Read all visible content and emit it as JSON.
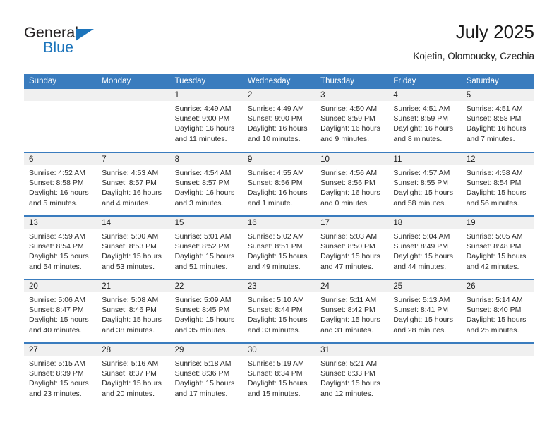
{
  "brand": {
    "name_top": "General",
    "name_bottom": "Blue",
    "triangle_color": "#1c74bb",
    "text_color": "#231f20"
  },
  "header": {
    "title": "July 2025",
    "subtitle": "Kojetin, Olomoucky, Czechia"
  },
  "theme": {
    "header_bg": "#3a7cbe",
    "header_text": "#ffffff",
    "daynum_band_bg": "#f0f0f0",
    "grid_line": "#3a7cbe",
    "body_text": "#2b2b2b"
  },
  "weekday_headers": [
    "Sunday",
    "Monday",
    "Tuesday",
    "Wednesday",
    "Thursday",
    "Friday",
    "Saturday"
  ],
  "labels": {
    "sunrise_prefix": "Sunrise:",
    "sunset_prefix": "Sunset:",
    "daylight_prefix": "Daylight:"
  },
  "weeks": [
    [
      {
        "day": "",
        "empty": true,
        "lines": []
      },
      {
        "day": "",
        "empty": true,
        "lines": []
      },
      {
        "day": "1",
        "empty": false,
        "lines": [
          "Sunrise: 4:49 AM",
          "Sunset: 9:00 PM",
          "Daylight: 16 hours",
          "and 11 minutes."
        ]
      },
      {
        "day": "2",
        "empty": false,
        "lines": [
          "Sunrise: 4:49 AM",
          "Sunset: 9:00 PM",
          "Daylight: 16 hours",
          "and 10 minutes."
        ]
      },
      {
        "day": "3",
        "empty": false,
        "lines": [
          "Sunrise: 4:50 AM",
          "Sunset: 8:59 PM",
          "Daylight: 16 hours",
          "and 9 minutes."
        ]
      },
      {
        "day": "4",
        "empty": false,
        "lines": [
          "Sunrise: 4:51 AM",
          "Sunset: 8:59 PM",
          "Daylight: 16 hours",
          "and 8 minutes."
        ]
      },
      {
        "day": "5",
        "empty": false,
        "lines": [
          "Sunrise: 4:51 AM",
          "Sunset: 8:58 PM",
          "Daylight: 16 hours",
          "and 7 minutes."
        ]
      }
    ],
    [
      {
        "day": "6",
        "empty": false,
        "lines": [
          "Sunrise: 4:52 AM",
          "Sunset: 8:58 PM",
          "Daylight: 16 hours",
          "and 5 minutes."
        ]
      },
      {
        "day": "7",
        "empty": false,
        "lines": [
          "Sunrise: 4:53 AM",
          "Sunset: 8:57 PM",
          "Daylight: 16 hours",
          "and 4 minutes."
        ]
      },
      {
        "day": "8",
        "empty": false,
        "lines": [
          "Sunrise: 4:54 AM",
          "Sunset: 8:57 PM",
          "Daylight: 16 hours",
          "and 3 minutes."
        ]
      },
      {
        "day": "9",
        "empty": false,
        "lines": [
          "Sunrise: 4:55 AM",
          "Sunset: 8:56 PM",
          "Daylight: 16 hours",
          "and 1 minute."
        ]
      },
      {
        "day": "10",
        "empty": false,
        "lines": [
          "Sunrise: 4:56 AM",
          "Sunset: 8:56 PM",
          "Daylight: 16 hours",
          "and 0 minutes."
        ]
      },
      {
        "day": "11",
        "empty": false,
        "lines": [
          "Sunrise: 4:57 AM",
          "Sunset: 8:55 PM",
          "Daylight: 15 hours",
          "and 58 minutes."
        ]
      },
      {
        "day": "12",
        "empty": false,
        "lines": [
          "Sunrise: 4:58 AM",
          "Sunset: 8:54 PM",
          "Daylight: 15 hours",
          "and 56 minutes."
        ]
      }
    ],
    [
      {
        "day": "13",
        "empty": false,
        "lines": [
          "Sunrise: 4:59 AM",
          "Sunset: 8:54 PM",
          "Daylight: 15 hours",
          "and 54 minutes."
        ]
      },
      {
        "day": "14",
        "empty": false,
        "lines": [
          "Sunrise: 5:00 AM",
          "Sunset: 8:53 PM",
          "Daylight: 15 hours",
          "and 53 minutes."
        ]
      },
      {
        "day": "15",
        "empty": false,
        "lines": [
          "Sunrise: 5:01 AM",
          "Sunset: 8:52 PM",
          "Daylight: 15 hours",
          "and 51 minutes."
        ]
      },
      {
        "day": "16",
        "empty": false,
        "lines": [
          "Sunrise: 5:02 AM",
          "Sunset: 8:51 PM",
          "Daylight: 15 hours",
          "and 49 minutes."
        ]
      },
      {
        "day": "17",
        "empty": false,
        "lines": [
          "Sunrise: 5:03 AM",
          "Sunset: 8:50 PM",
          "Daylight: 15 hours",
          "and 47 minutes."
        ]
      },
      {
        "day": "18",
        "empty": false,
        "lines": [
          "Sunrise: 5:04 AM",
          "Sunset: 8:49 PM",
          "Daylight: 15 hours",
          "and 44 minutes."
        ]
      },
      {
        "day": "19",
        "empty": false,
        "lines": [
          "Sunrise: 5:05 AM",
          "Sunset: 8:48 PM",
          "Daylight: 15 hours",
          "and 42 minutes."
        ]
      }
    ],
    [
      {
        "day": "20",
        "empty": false,
        "lines": [
          "Sunrise: 5:06 AM",
          "Sunset: 8:47 PM",
          "Daylight: 15 hours",
          "and 40 minutes."
        ]
      },
      {
        "day": "21",
        "empty": false,
        "lines": [
          "Sunrise: 5:08 AM",
          "Sunset: 8:46 PM",
          "Daylight: 15 hours",
          "and 38 minutes."
        ]
      },
      {
        "day": "22",
        "empty": false,
        "lines": [
          "Sunrise: 5:09 AM",
          "Sunset: 8:45 PM",
          "Daylight: 15 hours",
          "and 35 minutes."
        ]
      },
      {
        "day": "23",
        "empty": false,
        "lines": [
          "Sunrise: 5:10 AM",
          "Sunset: 8:44 PM",
          "Daylight: 15 hours",
          "and 33 minutes."
        ]
      },
      {
        "day": "24",
        "empty": false,
        "lines": [
          "Sunrise: 5:11 AM",
          "Sunset: 8:42 PM",
          "Daylight: 15 hours",
          "and 31 minutes."
        ]
      },
      {
        "day": "25",
        "empty": false,
        "lines": [
          "Sunrise: 5:13 AM",
          "Sunset: 8:41 PM",
          "Daylight: 15 hours",
          "and 28 minutes."
        ]
      },
      {
        "day": "26",
        "empty": false,
        "lines": [
          "Sunrise: 5:14 AM",
          "Sunset: 8:40 PM",
          "Daylight: 15 hours",
          "and 25 minutes."
        ]
      }
    ],
    [
      {
        "day": "27",
        "empty": false,
        "lines": [
          "Sunrise: 5:15 AM",
          "Sunset: 8:39 PM",
          "Daylight: 15 hours",
          "and 23 minutes."
        ]
      },
      {
        "day": "28",
        "empty": false,
        "lines": [
          "Sunrise: 5:16 AM",
          "Sunset: 8:37 PM",
          "Daylight: 15 hours",
          "and 20 minutes."
        ]
      },
      {
        "day": "29",
        "empty": false,
        "lines": [
          "Sunrise: 5:18 AM",
          "Sunset: 8:36 PM",
          "Daylight: 15 hours",
          "and 17 minutes."
        ]
      },
      {
        "day": "30",
        "empty": false,
        "lines": [
          "Sunrise: 5:19 AM",
          "Sunset: 8:34 PM",
          "Daylight: 15 hours",
          "and 15 minutes."
        ]
      },
      {
        "day": "31",
        "empty": false,
        "lines": [
          "Sunrise: 5:21 AM",
          "Sunset: 8:33 PM",
          "Daylight: 15 hours",
          "and 12 minutes."
        ]
      },
      {
        "day": "",
        "empty": true,
        "lines": []
      },
      {
        "day": "",
        "empty": true,
        "lines": []
      }
    ]
  ]
}
